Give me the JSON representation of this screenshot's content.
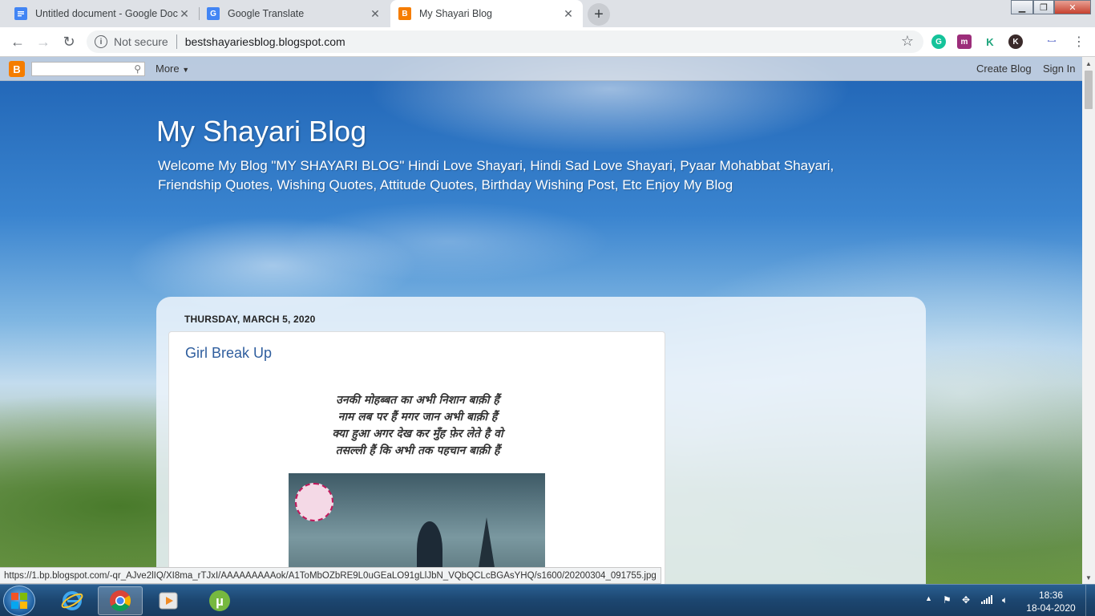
{
  "browser": {
    "tabs": [
      {
        "title": "Untitled document - Google Docs",
        "favicon": "docs-icon",
        "color": "#4285f4"
      },
      {
        "title": "Google Translate",
        "favicon": "translate-icon",
        "color": "#4285f4"
      },
      {
        "title": "My Shayari Blog",
        "favicon": "blogger-icon",
        "color": "#f57d00",
        "active": true
      }
    ],
    "omnibox": {
      "security": "Not secure",
      "url": "bestshayariesblog.blogspot.com"
    }
  },
  "blogger_bar": {
    "logo": "B",
    "more": "More",
    "create_blog": "Create Blog",
    "sign_in": "Sign In"
  },
  "blog": {
    "title": "My Shayari Blog",
    "description": "Welcome My Blog \"MY SHAYARI BLOG\" Hindi Love Shayari, Hindi Sad Love Shayari, Pyaar Mohabbat Shayari, Friendship Quotes, Wishing Quotes, Attitude Quotes, Birthday Wishing Post, Etc Enjoy My Blog",
    "date_header": "THURSDAY, MARCH 5, 2020",
    "post": {
      "title": "Girl Break Up",
      "poem": [
        "उनकी मोहब्बत का अभी निशान बाक़ी हैं",
        "नाम लब पर हैं मगर जान अभी बाक़ी हैं",
        "क्या हुआ अगर देख कर मुँह फ़ेर लेते है वो",
        "तसल्ली हैं कि अभी तक पहचान बाक़ी हैं"
      ]
    }
  },
  "status_url": "https://1.bp.blogspot.com/-qr_AJve2lIQ/XI8ma_rTJxI/AAAAAAAAAok/A1ToMbOZbRE9L0uGEaLO91gLlJbN_VQbQCLcBGAsYHQ/s1600/20200304_091755.jpg",
  "taskbar": {
    "apps": [
      "internet-explorer-icon",
      "chrome-icon",
      "media-player-icon",
      "utorrent-icon"
    ],
    "time": "18:36",
    "date": "18-04-2020"
  }
}
